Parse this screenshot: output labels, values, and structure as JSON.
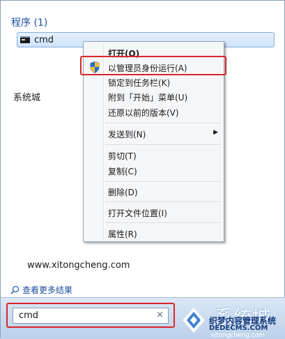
{
  "results": {
    "section_title": "程序 (1)",
    "items": [
      {
        "label": "cmd",
        "icon": "cmd-icon"
      }
    ],
    "see_more": "查看更多结果"
  },
  "overlay": {
    "watermark": "系统城",
    "website": "www.xitongcheng.com"
  },
  "search": {
    "value": "cmd",
    "clear_icon": "×"
  },
  "context_menu": {
    "items": [
      {
        "label": "打开(O)",
        "bold": true
      },
      {
        "label": "以管理员身份运行(A)",
        "icon": "shield-icon"
      },
      {
        "label": "锁定到任务栏(K)"
      },
      {
        "label": "附到「开始」菜单(U)"
      },
      {
        "label": "还原以前的版本(V)"
      },
      {
        "label": "发送到(N)",
        "submenu": true,
        "arrow": "▶"
      },
      {
        "label": "剪切(T)"
      },
      {
        "label": "复制(C)"
      },
      {
        "label": "删除(D)"
      },
      {
        "label": "打开文件位置(I)"
      },
      {
        "label": "属性(R)"
      }
    ]
  },
  "logo": {
    "big": "系统城",
    "mid": "织梦内容管理系统",
    "small": "DEDECMS.COM",
    "tiny": "xitongcheng.com"
  },
  "colors": {
    "highlight_box": "#d9262b",
    "link_blue": "#1f4ea0",
    "bottom_bar": "#c7d9ef"
  }
}
